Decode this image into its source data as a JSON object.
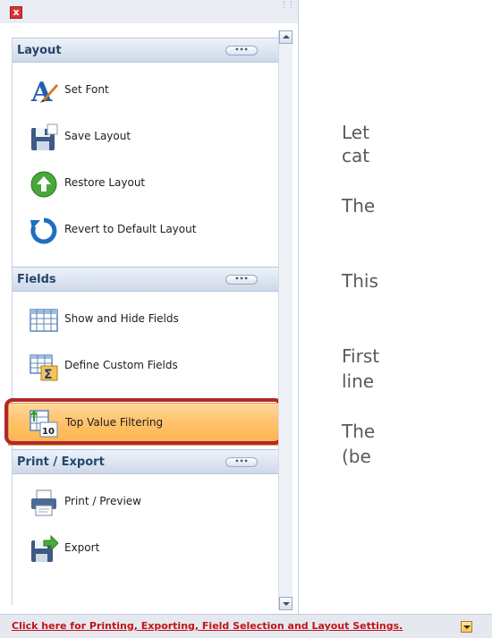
{
  "window": {
    "close_label": "x"
  },
  "groups": [
    {
      "title": "Layout",
      "more": "•••"
    },
    {
      "title": "Fields",
      "more": "•••"
    },
    {
      "title": "Print / Export",
      "more": "•••"
    }
  ],
  "items": [
    {
      "label": "Set Font",
      "icon": "font-icon"
    },
    {
      "label": "Save Layout",
      "icon": "save-icon"
    },
    {
      "label": "Restore Layout",
      "icon": "restore-icon"
    },
    {
      "label": "Revert to Default Layout",
      "icon": "revert-icon"
    },
    {
      "label": "Show and Hide Fields",
      "icon": "table-grid-icon"
    },
    {
      "label": "Define Custom Fields",
      "icon": "sigma-icon"
    },
    {
      "label": "Top Value Filtering",
      "icon": "top-value-icon",
      "badge": "10",
      "selected": true
    },
    {
      "label": "Print / Preview",
      "icon": "printer-icon"
    },
    {
      "label": "Export",
      "icon": "export-icon"
    }
  ],
  "bottom": {
    "link_text": "Click here for Printing, Exporting, Field Selection and Layout Settings."
  },
  "document": {
    "lines": [
      "Let",
      "cat",
      "The",
      "This",
      "First",
      "line",
      "The",
      "(be"
    ]
  },
  "colors": {
    "highlight": "#b0262e",
    "selected": "#ffc36c",
    "header": "#24466b"
  }
}
